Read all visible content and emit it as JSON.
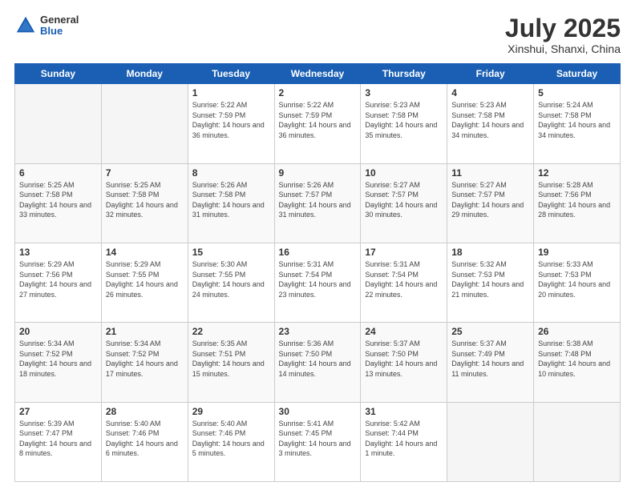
{
  "header": {
    "logo_general": "General",
    "logo_blue": "Blue",
    "month_title": "July 2025",
    "location": "Xinshui, Shanxi, China"
  },
  "days_of_week": [
    "Sunday",
    "Monday",
    "Tuesday",
    "Wednesday",
    "Thursday",
    "Friday",
    "Saturday"
  ],
  "weeks": [
    [
      {
        "day": null
      },
      {
        "day": null
      },
      {
        "day": "1",
        "sunrise": "Sunrise: 5:22 AM",
        "sunset": "Sunset: 7:59 PM",
        "daylight": "Daylight: 14 hours and 36 minutes."
      },
      {
        "day": "2",
        "sunrise": "Sunrise: 5:22 AM",
        "sunset": "Sunset: 7:59 PM",
        "daylight": "Daylight: 14 hours and 36 minutes."
      },
      {
        "day": "3",
        "sunrise": "Sunrise: 5:23 AM",
        "sunset": "Sunset: 7:58 PM",
        "daylight": "Daylight: 14 hours and 35 minutes."
      },
      {
        "day": "4",
        "sunrise": "Sunrise: 5:23 AM",
        "sunset": "Sunset: 7:58 PM",
        "daylight": "Daylight: 14 hours and 34 minutes."
      },
      {
        "day": "5",
        "sunrise": "Sunrise: 5:24 AM",
        "sunset": "Sunset: 7:58 PM",
        "daylight": "Daylight: 14 hours and 34 minutes."
      }
    ],
    [
      {
        "day": "6",
        "sunrise": "Sunrise: 5:25 AM",
        "sunset": "Sunset: 7:58 PM",
        "daylight": "Daylight: 14 hours and 33 minutes."
      },
      {
        "day": "7",
        "sunrise": "Sunrise: 5:25 AM",
        "sunset": "Sunset: 7:58 PM",
        "daylight": "Daylight: 14 hours and 32 minutes."
      },
      {
        "day": "8",
        "sunrise": "Sunrise: 5:26 AM",
        "sunset": "Sunset: 7:58 PM",
        "daylight": "Daylight: 14 hours and 31 minutes."
      },
      {
        "day": "9",
        "sunrise": "Sunrise: 5:26 AM",
        "sunset": "Sunset: 7:57 PM",
        "daylight": "Daylight: 14 hours and 31 minutes."
      },
      {
        "day": "10",
        "sunrise": "Sunrise: 5:27 AM",
        "sunset": "Sunset: 7:57 PM",
        "daylight": "Daylight: 14 hours and 30 minutes."
      },
      {
        "day": "11",
        "sunrise": "Sunrise: 5:27 AM",
        "sunset": "Sunset: 7:57 PM",
        "daylight": "Daylight: 14 hours and 29 minutes."
      },
      {
        "day": "12",
        "sunrise": "Sunrise: 5:28 AM",
        "sunset": "Sunset: 7:56 PM",
        "daylight": "Daylight: 14 hours and 28 minutes."
      }
    ],
    [
      {
        "day": "13",
        "sunrise": "Sunrise: 5:29 AM",
        "sunset": "Sunset: 7:56 PM",
        "daylight": "Daylight: 14 hours and 27 minutes."
      },
      {
        "day": "14",
        "sunrise": "Sunrise: 5:29 AM",
        "sunset": "Sunset: 7:55 PM",
        "daylight": "Daylight: 14 hours and 26 minutes."
      },
      {
        "day": "15",
        "sunrise": "Sunrise: 5:30 AM",
        "sunset": "Sunset: 7:55 PM",
        "daylight": "Daylight: 14 hours and 24 minutes."
      },
      {
        "day": "16",
        "sunrise": "Sunrise: 5:31 AM",
        "sunset": "Sunset: 7:54 PM",
        "daylight": "Daylight: 14 hours and 23 minutes."
      },
      {
        "day": "17",
        "sunrise": "Sunrise: 5:31 AM",
        "sunset": "Sunset: 7:54 PM",
        "daylight": "Daylight: 14 hours and 22 minutes."
      },
      {
        "day": "18",
        "sunrise": "Sunrise: 5:32 AM",
        "sunset": "Sunset: 7:53 PM",
        "daylight": "Daylight: 14 hours and 21 minutes."
      },
      {
        "day": "19",
        "sunrise": "Sunrise: 5:33 AM",
        "sunset": "Sunset: 7:53 PM",
        "daylight": "Daylight: 14 hours and 20 minutes."
      }
    ],
    [
      {
        "day": "20",
        "sunrise": "Sunrise: 5:34 AM",
        "sunset": "Sunset: 7:52 PM",
        "daylight": "Daylight: 14 hours and 18 minutes."
      },
      {
        "day": "21",
        "sunrise": "Sunrise: 5:34 AM",
        "sunset": "Sunset: 7:52 PM",
        "daylight": "Daylight: 14 hours and 17 minutes."
      },
      {
        "day": "22",
        "sunrise": "Sunrise: 5:35 AM",
        "sunset": "Sunset: 7:51 PM",
        "daylight": "Daylight: 14 hours and 15 minutes."
      },
      {
        "day": "23",
        "sunrise": "Sunrise: 5:36 AM",
        "sunset": "Sunset: 7:50 PM",
        "daylight": "Daylight: 14 hours and 14 minutes."
      },
      {
        "day": "24",
        "sunrise": "Sunrise: 5:37 AM",
        "sunset": "Sunset: 7:50 PM",
        "daylight": "Daylight: 14 hours and 13 minutes."
      },
      {
        "day": "25",
        "sunrise": "Sunrise: 5:37 AM",
        "sunset": "Sunset: 7:49 PM",
        "daylight": "Daylight: 14 hours and 11 minutes."
      },
      {
        "day": "26",
        "sunrise": "Sunrise: 5:38 AM",
        "sunset": "Sunset: 7:48 PM",
        "daylight": "Daylight: 14 hours and 10 minutes."
      }
    ],
    [
      {
        "day": "27",
        "sunrise": "Sunrise: 5:39 AM",
        "sunset": "Sunset: 7:47 PM",
        "daylight": "Daylight: 14 hours and 8 minutes."
      },
      {
        "day": "28",
        "sunrise": "Sunrise: 5:40 AM",
        "sunset": "Sunset: 7:46 PM",
        "daylight": "Daylight: 14 hours and 6 minutes."
      },
      {
        "day": "29",
        "sunrise": "Sunrise: 5:40 AM",
        "sunset": "Sunset: 7:46 PM",
        "daylight": "Daylight: 14 hours and 5 minutes."
      },
      {
        "day": "30",
        "sunrise": "Sunrise: 5:41 AM",
        "sunset": "Sunset: 7:45 PM",
        "daylight": "Daylight: 14 hours and 3 minutes."
      },
      {
        "day": "31",
        "sunrise": "Sunrise: 5:42 AM",
        "sunset": "Sunset: 7:44 PM",
        "daylight": "Daylight: 14 hours and 1 minute."
      },
      {
        "day": null
      },
      {
        "day": null
      }
    ]
  ]
}
